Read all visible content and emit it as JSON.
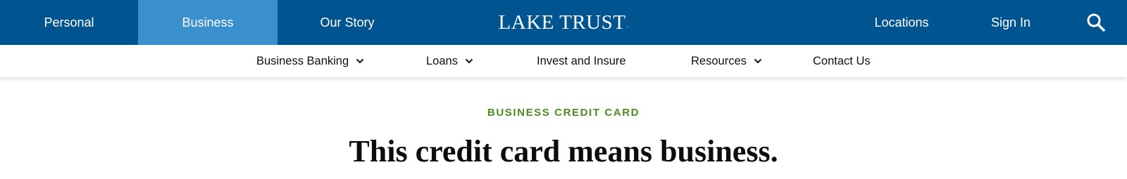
{
  "topnav": {
    "personal": "Personal",
    "business": "Business",
    "our_story": "Our Story",
    "logo": "LAKE TRUST",
    "logo_mark": ".",
    "locations": "Locations",
    "sign_in": "Sign In",
    "search_icon": "search-icon"
  },
  "subnav": {
    "items": [
      {
        "label": "Business Banking",
        "has_dropdown": true
      },
      {
        "label": "Loans",
        "has_dropdown": true
      },
      {
        "label": "Invest and Insure",
        "has_dropdown": false
      },
      {
        "label": "Resources",
        "has_dropdown": true
      },
      {
        "label": "Contact Us",
        "has_dropdown": false
      }
    ]
  },
  "hero": {
    "eyebrow": "BUSINESS CREDIT CARD",
    "headline": "This credit card means business."
  },
  "colors": {
    "nav_blue": "#005591",
    "active_tab": "#3a8fcd",
    "eyebrow_green": "#4a8d1f"
  }
}
